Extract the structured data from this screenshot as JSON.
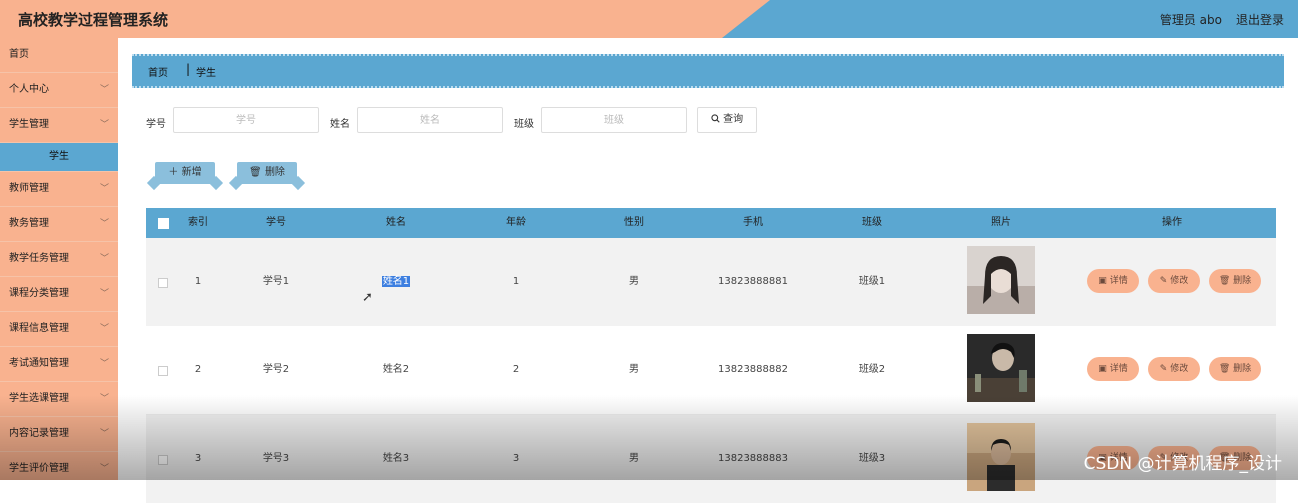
{
  "header": {
    "title": "高校教学过程管理系统",
    "user": "管理员 abo",
    "logout": "退出登录"
  },
  "sidebar": {
    "items": [
      {
        "label": "首页",
        "chevron": false
      },
      {
        "label": "个人中心",
        "chevron": true
      },
      {
        "label": "学生管理",
        "chevron": true
      },
      {
        "label": "学生",
        "sub": true
      },
      {
        "label": "教师管理",
        "chevron": true
      },
      {
        "label": "教务管理",
        "chevron": true
      },
      {
        "label": "教学任务管理",
        "chevron": true
      },
      {
        "label": "课程分类管理",
        "chevron": true
      },
      {
        "label": "课程信息管理",
        "chevron": true
      },
      {
        "label": "考试通知管理",
        "chevron": true
      },
      {
        "label": "学生选课管理",
        "chevron": true
      },
      {
        "label": "内容记录管理",
        "chevron": true
      },
      {
        "label": "学生评价管理",
        "chevron": true
      }
    ],
    "chevron_glyph": "﹀"
  },
  "breadcrumb": {
    "home": "首页",
    "separator": "|",
    "current": "学生"
  },
  "search": {
    "id_label": "学号",
    "id_placeholder": "学号",
    "name_label": "姓名",
    "name_placeholder": "姓名",
    "class_label": "班级",
    "class_placeholder": "班级",
    "button": "查询"
  },
  "actions": {
    "add": "新增",
    "delete": "删除"
  },
  "table": {
    "headers": [
      "索引",
      "学号",
      "姓名",
      "年龄",
      "性别",
      "手机",
      "班级",
      "照片",
      "操作"
    ],
    "ops": {
      "detail": "详情",
      "edit": "修改",
      "delete": "删除"
    },
    "rows": [
      {
        "index": "1",
        "student_id": "学号1",
        "name": "姓名1",
        "age": "1",
        "gender": "男",
        "phone": "13823888881",
        "class": "班级1"
      },
      {
        "index": "2",
        "student_id": "学号2",
        "name": "姓名2",
        "age": "2",
        "gender": "男",
        "phone": "13823888882",
        "class": "班级2"
      },
      {
        "index": "3",
        "student_id": "学号3",
        "name": "姓名3",
        "age": "3",
        "gender": "男",
        "phone": "13823888883",
        "class": "班级3"
      }
    ]
  },
  "watermark": "CSDN @计算机程序_设计",
  "colors": {
    "accent_blue": "#5ba7d1",
    "accent_peach": "#f9b28f"
  }
}
